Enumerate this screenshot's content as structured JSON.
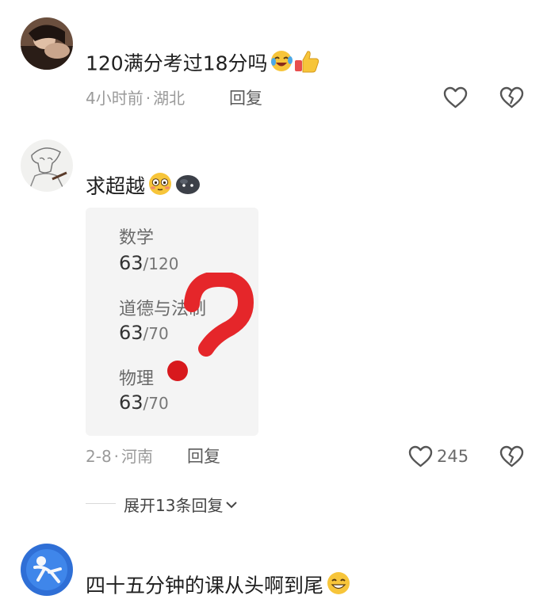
{
  "comments": [
    {
      "text": "120满分考过18分吗",
      "emojis": [
        "rolling-laughing-emoji",
        "thumbs-up-emoji"
      ],
      "time": "4小时前",
      "location": "湖北",
      "reply_label": "回复"
    },
    {
      "text": "求超越",
      "emojis": [
        "flushed-face-emoji",
        "dark-blob-emoji"
      ],
      "time": "2-8",
      "location": "河南",
      "reply_label": "回复",
      "like_count": "245",
      "image_card": {
        "subjects": [
          {
            "name": "数学",
            "score": "63",
            "total": "/120"
          },
          {
            "name": "道德与法制",
            "score": "63",
            "total": "/70"
          },
          {
            "name": "物理",
            "score": "63",
            "total": "/70"
          }
        ],
        "overlay": "red-question-mark"
      },
      "expand_label": "展开13条回复"
    },
    {
      "text": "四十五分钟的课从头啊到尾",
      "emojis": [
        "grinning-face-emoji"
      ]
    }
  ],
  "meta_separator": "·",
  "colors": {
    "background": "#ffffff",
    "meta": "#9a9a9a",
    "question_mark": "#e5262a"
  }
}
